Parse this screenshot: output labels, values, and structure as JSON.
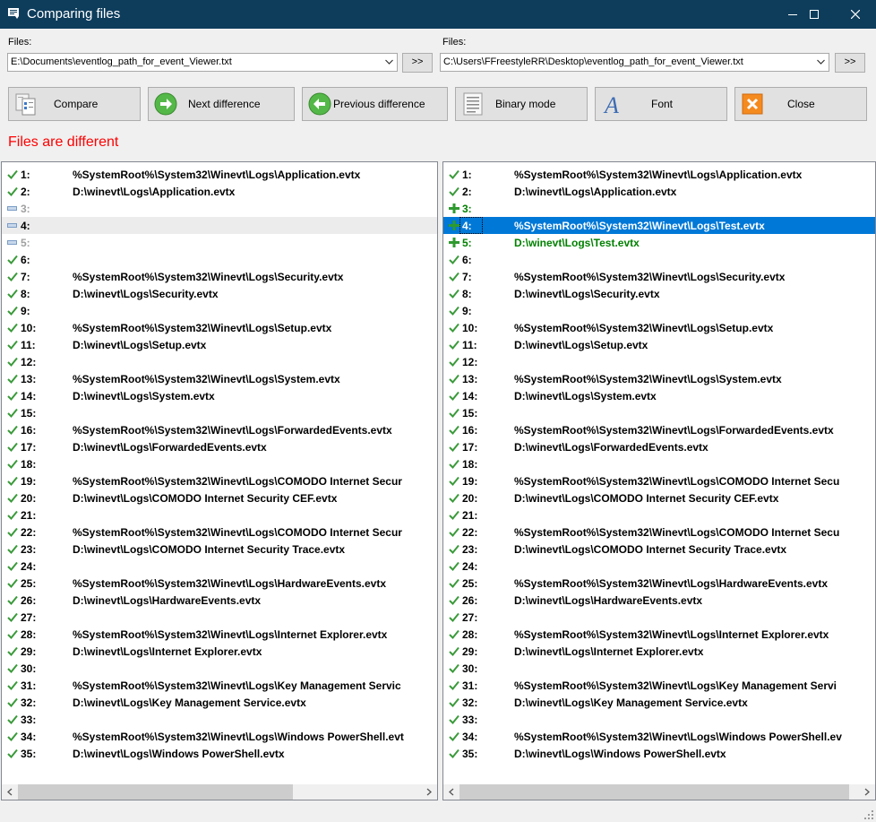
{
  "window": {
    "title": "Comparing files"
  },
  "files": {
    "label_left": "Files:",
    "label_right": "Files:",
    "left_path": "E:\\Documents\\eventlog_path_for_event_Viewer.txt",
    "right_path": "C:\\Users\\FFreestyleRR\\Desktop\\eventlog_path_for_event_Viewer.txt",
    "browse_label": ">>"
  },
  "toolbar": {
    "compare": "Compare",
    "next": "Next difference",
    "previous": "Previous difference",
    "binary": "Binary mode",
    "font": "Font",
    "close": "Close"
  },
  "status": {
    "text": "Files are different",
    "color": "#ff0000"
  },
  "left_lines": [
    {
      "num": "1:",
      "text": "%SystemRoot%\\System32\\Winevt\\Logs\\Application.evtx",
      "state": "same"
    },
    {
      "num": "2:",
      "text": "D:\\winevt\\Logs\\Application.evtx",
      "state": "same"
    },
    {
      "num": "3:",
      "text": "",
      "state": "missing"
    },
    {
      "num": "4:",
      "text": "",
      "state": "missing-current"
    },
    {
      "num": "5:",
      "text": "",
      "state": "missing"
    },
    {
      "num": "6:",
      "text": "",
      "state": "same"
    },
    {
      "num": "7:",
      "text": "%SystemRoot%\\System32\\Winevt\\Logs\\Security.evtx",
      "state": "same"
    },
    {
      "num": "8:",
      "text": "D:\\winevt\\Logs\\Security.evtx",
      "state": "same"
    },
    {
      "num": "9:",
      "text": "",
      "state": "same"
    },
    {
      "num": "10:",
      "text": "%SystemRoot%\\System32\\Winevt\\Logs\\Setup.evtx",
      "state": "same"
    },
    {
      "num": "11:",
      "text": "D:\\winevt\\Logs\\Setup.evtx",
      "state": "same"
    },
    {
      "num": "12:",
      "text": "",
      "state": "same"
    },
    {
      "num": "13:",
      "text": "%SystemRoot%\\System32\\Winevt\\Logs\\System.evtx",
      "state": "same"
    },
    {
      "num": "14:",
      "text": "D:\\winevt\\Logs\\System.evtx",
      "state": "same"
    },
    {
      "num": "15:",
      "text": "",
      "state": "same"
    },
    {
      "num": "16:",
      "text": "%SystemRoot%\\System32\\Winevt\\Logs\\ForwardedEvents.evtx",
      "state": "same"
    },
    {
      "num": "17:",
      "text": "D:\\winevt\\Logs\\ForwardedEvents.evtx",
      "state": "same"
    },
    {
      "num": "18:",
      "text": "",
      "state": "same"
    },
    {
      "num": "19:",
      "text": "%SystemRoot%\\System32\\Winevt\\Logs\\COMODO Internet Secur",
      "state": "same"
    },
    {
      "num": "20:",
      "text": "D:\\winevt\\Logs\\COMODO Internet Security CEF.evtx",
      "state": "same"
    },
    {
      "num": "21:",
      "text": "",
      "state": "same"
    },
    {
      "num": "22:",
      "text": "%SystemRoot%\\System32\\Winevt\\Logs\\COMODO Internet Secur",
      "state": "same"
    },
    {
      "num": "23:",
      "text": "D:\\winevt\\Logs\\COMODO Internet Security Trace.evtx",
      "state": "same"
    },
    {
      "num": "24:",
      "text": "",
      "state": "same"
    },
    {
      "num": "25:",
      "text": "%SystemRoot%\\System32\\Winevt\\Logs\\HardwareEvents.evtx",
      "state": "same"
    },
    {
      "num": "26:",
      "text": "D:\\winevt\\Logs\\HardwareEvents.evtx",
      "state": "same"
    },
    {
      "num": "27:",
      "text": "",
      "state": "same"
    },
    {
      "num": "28:",
      "text": "%SystemRoot%\\System32\\Winevt\\Logs\\Internet Explorer.evtx",
      "state": "same"
    },
    {
      "num": "29:",
      "text": "D:\\winevt\\Logs\\Internet Explorer.evtx",
      "state": "same"
    },
    {
      "num": "30:",
      "text": "",
      "state": "same"
    },
    {
      "num": "31:",
      "text": "%SystemRoot%\\System32\\Winevt\\Logs\\Key Management Servic",
      "state": "same"
    },
    {
      "num": "32:",
      "text": "D:\\winevt\\Logs\\Key Management Service.evtx",
      "state": "same"
    },
    {
      "num": "33:",
      "text": "",
      "state": "same"
    },
    {
      "num": "34:",
      "text": "%SystemRoot%\\System32\\Winevt\\Logs\\Windows PowerShell.evt",
      "state": "same"
    },
    {
      "num": "35:",
      "text": "D:\\winevt\\Logs\\Windows PowerShell.evtx",
      "state": "same"
    }
  ],
  "right_lines": [
    {
      "num": "1:",
      "text": "%SystemRoot%\\System32\\Winevt\\Logs\\Application.evtx",
      "state": "same"
    },
    {
      "num": "2:",
      "text": "D:\\winevt\\Logs\\Application.evtx",
      "state": "same"
    },
    {
      "num": "3:",
      "text": "",
      "state": "added"
    },
    {
      "num": "4:",
      "text": "%SystemRoot%\\System32\\Winevt\\Logs\\Test.evtx",
      "state": "added-selected"
    },
    {
      "num": "5:",
      "text": "D:\\winevt\\Logs\\Test.evtx",
      "state": "added"
    },
    {
      "num": "6:",
      "text": "",
      "state": "same"
    },
    {
      "num": "7:",
      "text": "%SystemRoot%\\System32\\Winevt\\Logs\\Security.evtx",
      "state": "same"
    },
    {
      "num": "8:",
      "text": "D:\\winevt\\Logs\\Security.evtx",
      "state": "same"
    },
    {
      "num": "9:",
      "text": "",
      "state": "same"
    },
    {
      "num": "10:",
      "text": "%SystemRoot%\\System32\\Winevt\\Logs\\Setup.evtx",
      "state": "same"
    },
    {
      "num": "11:",
      "text": "D:\\winevt\\Logs\\Setup.evtx",
      "state": "same"
    },
    {
      "num": "12:",
      "text": "",
      "state": "same"
    },
    {
      "num": "13:",
      "text": "%SystemRoot%\\System32\\Winevt\\Logs\\System.evtx",
      "state": "same"
    },
    {
      "num": "14:",
      "text": "D:\\winevt\\Logs\\System.evtx",
      "state": "same"
    },
    {
      "num": "15:",
      "text": "",
      "state": "same"
    },
    {
      "num": "16:",
      "text": "%SystemRoot%\\System32\\Winevt\\Logs\\ForwardedEvents.evtx",
      "state": "same"
    },
    {
      "num": "17:",
      "text": "D:\\winevt\\Logs\\ForwardedEvents.evtx",
      "state": "same"
    },
    {
      "num": "18:",
      "text": "",
      "state": "same"
    },
    {
      "num": "19:",
      "text": "%SystemRoot%\\System32\\Winevt\\Logs\\COMODO Internet Secu",
      "state": "same"
    },
    {
      "num": "20:",
      "text": "D:\\winevt\\Logs\\COMODO Internet Security CEF.evtx",
      "state": "same"
    },
    {
      "num": "21:",
      "text": "",
      "state": "same"
    },
    {
      "num": "22:",
      "text": "%SystemRoot%\\System32\\Winevt\\Logs\\COMODO Internet Secu",
      "state": "same"
    },
    {
      "num": "23:",
      "text": "D:\\winevt\\Logs\\COMODO Internet Security Trace.evtx",
      "state": "same"
    },
    {
      "num": "24:",
      "text": "",
      "state": "same"
    },
    {
      "num": "25:",
      "text": "%SystemRoot%\\System32\\Winevt\\Logs\\HardwareEvents.evtx",
      "state": "same"
    },
    {
      "num": "26:",
      "text": "D:\\winevt\\Logs\\HardwareEvents.evtx",
      "state": "same"
    },
    {
      "num": "27:",
      "text": "",
      "state": "same"
    },
    {
      "num": "28:",
      "text": "%SystemRoot%\\System32\\Winevt\\Logs\\Internet Explorer.evtx",
      "state": "same"
    },
    {
      "num": "29:",
      "text": "D:\\winevt\\Logs\\Internet Explorer.evtx",
      "state": "same"
    },
    {
      "num": "30:",
      "text": "",
      "state": "same"
    },
    {
      "num": "31:",
      "text": "%SystemRoot%\\System32\\Winevt\\Logs\\Key Management Servi",
      "state": "same"
    },
    {
      "num": "32:",
      "text": "D:\\winevt\\Logs\\Key Management Service.evtx",
      "state": "same"
    },
    {
      "num": "33:",
      "text": "",
      "state": "same"
    },
    {
      "num": "34:",
      "text": "%SystemRoot%\\System32\\Winevt\\Logs\\Windows PowerShell.ev",
      "state": "same"
    },
    {
      "num": "35:",
      "text": "D:\\winevt\\Logs\\Windows PowerShell.evtx",
      "state": "same"
    }
  ],
  "colors": {
    "titlebar": "#0e3d5c",
    "same_check": "#3a9a3a",
    "added": "#008000",
    "selection": "#0078d7"
  }
}
